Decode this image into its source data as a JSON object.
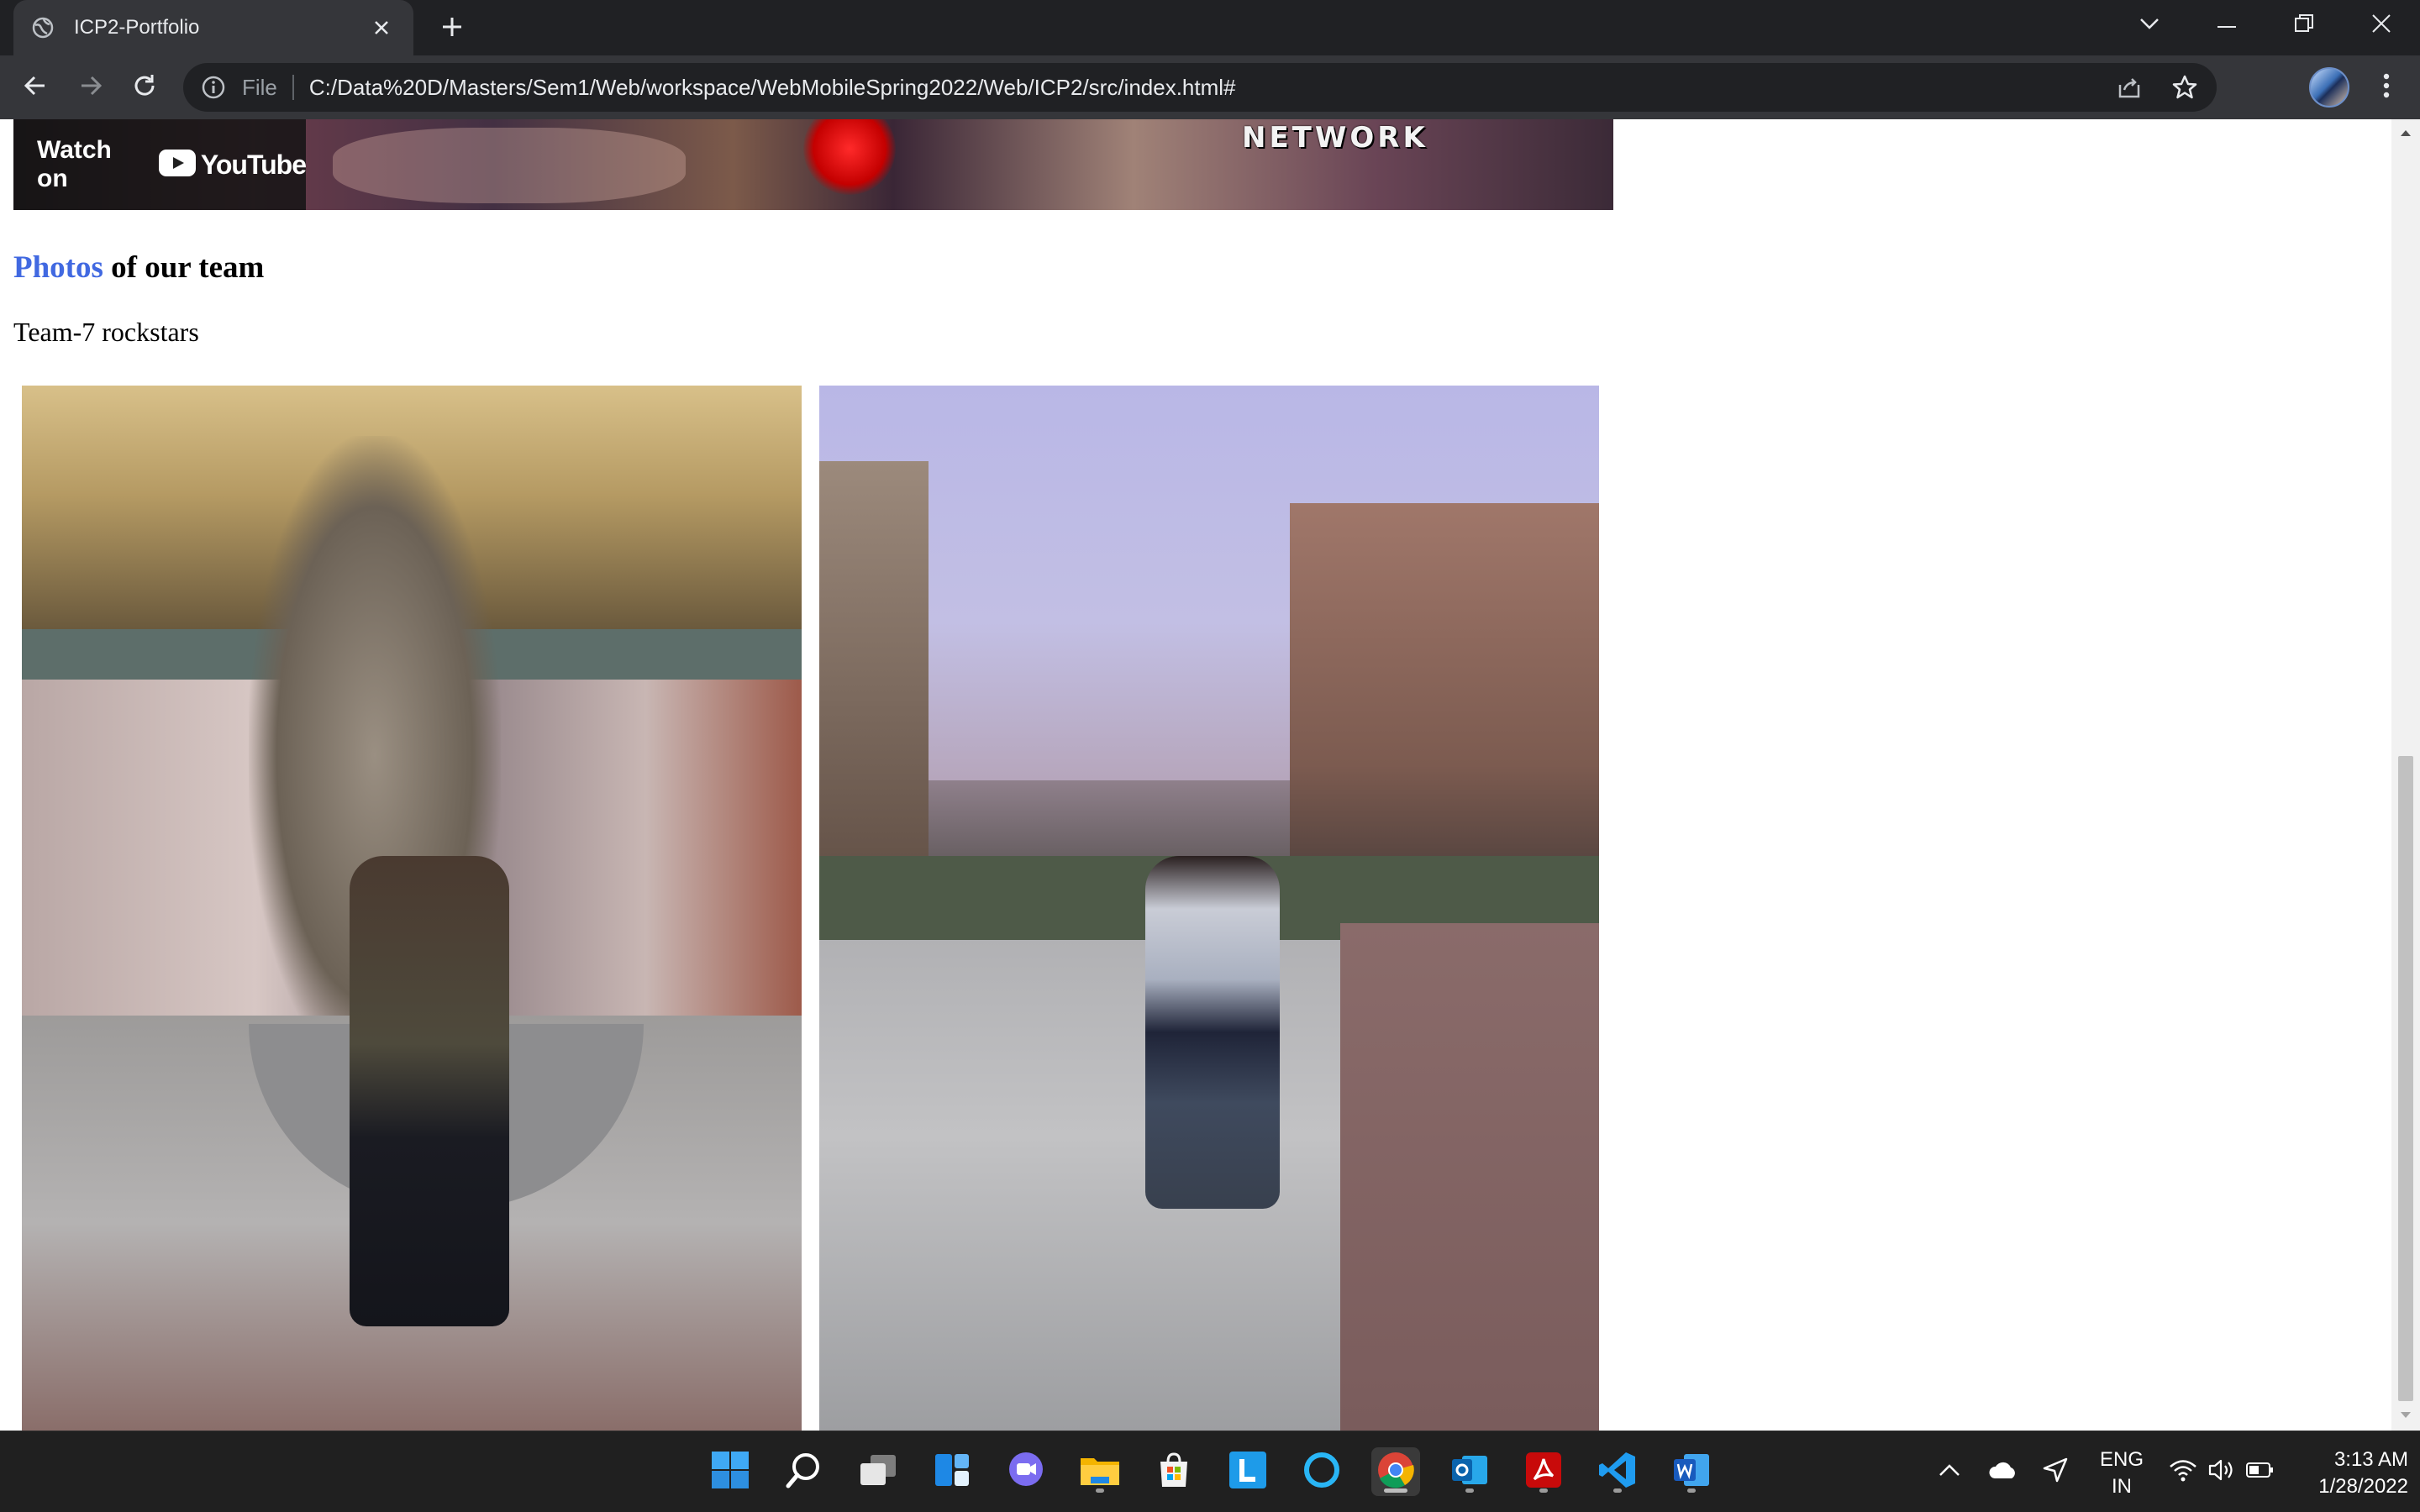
{
  "browser": {
    "tab": {
      "title": "ICP2-Portfolio",
      "favicon": "globe-icon",
      "close_icon": "close-icon"
    },
    "new_tab_icon": "plus-icon",
    "window_controls": [
      "chevron-down-icon",
      "minimize-icon",
      "restore-icon",
      "close-icon"
    ],
    "nav": [
      "back-arrow-icon",
      "forward-arrow-icon",
      "reload-icon"
    ],
    "omnibox": {
      "scheme_label": "File",
      "url": "C:/Data%20D/Masters/Sem1/Web/workspace/WebMobileSpring2022/Web/ICP2/src/index.html#",
      "actions": [
        "share-icon",
        "bookmark-star-icon"
      ]
    },
    "accent": "#35363a"
  },
  "page": {
    "video": {
      "watch_on": "Watch on",
      "platform": "YouTube",
      "channel_logo": "NETWORK"
    },
    "section": {
      "highlight": "Photos",
      "rest": " of our team",
      "highlight_color": "#4169e1"
    },
    "caption": "Team-7 rockstars",
    "photos": [
      {
        "subject": "team member seated on planter outside theater"
      },
      {
        "subject": "team member standing on outdoor shopping street"
      }
    ]
  },
  "taskbar": {
    "apps": [
      "windows-start-icon",
      "search-icon",
      "task-view-icon",
      "widgets-icon",
      "teams-chat-icon",
      "file-explorer-icon",
      "microsoft-store-icon",
      "l-app-icon",
      "cortana-icon",
      "chrome-icon",
      "outlook-icon",
      "acrobat-icon",
      "vscode-icon",
      "word-icon"
    ],
    "tray": {
      "lang_line1": "ENG",
      "lang_line2": "IN",
      "time": "3:13 AM",
      "date": "1/28/2022"
    }
  }
}
